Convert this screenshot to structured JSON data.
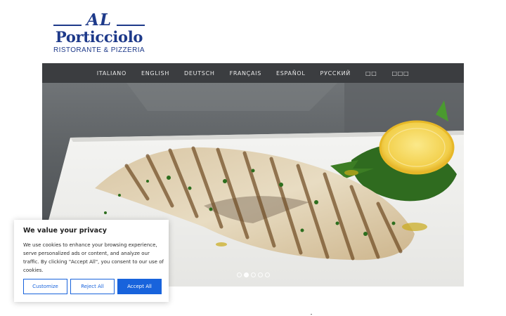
{
  "logo": {
    "top": "AL",
    "name": "Porticciolo",
    "subtitle": "RISTORANTE & PIZZERIA",
    "color": "#1e3a8a"
  },
  "nav": {
    "background": "#3b3d40",
    "items": [
      {
        "label": "ITALIANO"
      },
      {
        "label": "ENGLISH"
      },
      {
        "label": "DEUTSCH"
      },
      {
        "label": "FRANÇAIS"
      },
      {
        "label": "ESPAÑOL"
      },
      {
        "label": "РУССКИЙ"
      },
      {
        "label": "□□"
      },
      {
        "label": "□□□"
      }
    ]
  },
  "slider": {
    "slide_count": 5,
    "active_slide": 2,
    "image_subject": "grilled fish fillet on white plate with lemon and arugula"
  },
  "cookie": {
    "title": "We value your privacy",
    "text": "We use cookies to enhance your browsing experience, serve personalized ads or content, and analyze our traffic. By clicking \"Accept All\", you consent to our use of cookies.",
    "customize": "Customize",
    "reject": "Reject All",
    "accept": "Accept All",
    "accent": "#1863dc"
  }
}
